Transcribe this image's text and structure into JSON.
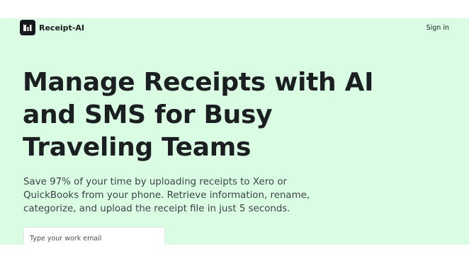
{
  "brand": {
    "name": "Receipt-AI",
    "logo_icon": "receipt-ai-logo-icon"
  },
  "nav": {
    "signin_label": "Sign in"
  },
  "hero": {
    "title": "Manage Receipts with AI and SMS for Busy Traveling Teams",
    "subtitle": "Save 97% of your time by uploading receipts to Xero or QuickBooks from your phone. Retrieve information, rename, categorize, and upload the receipt file in just 5 seconds."
  },
  "signup": {
    "email_placeholder": "Type your work email",
    "email_value": ""
  },
  "colors": {
    "background": "#d9fce3",
    "text_dark": "#1c1f22",
    "logo_bg": "#16181b"
  }
}
